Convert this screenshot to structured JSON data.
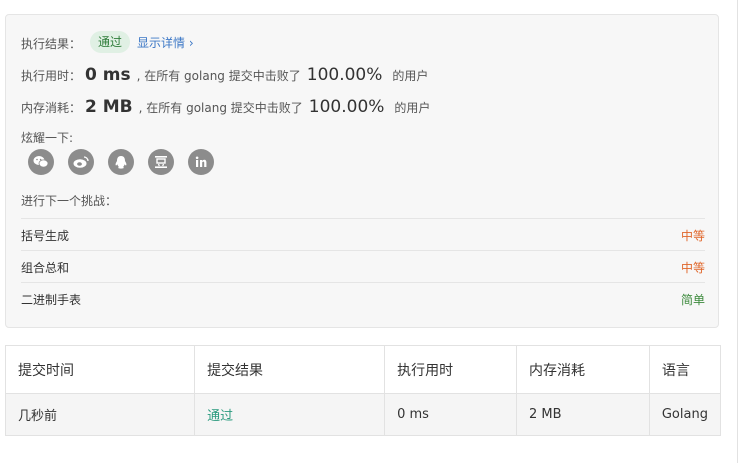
{
  "result": {
    "label": "执行结果：",
    "status": "通过",
    "details_link": "显示详情 ›"
  },
  "runtime": {
    "label": "执行用时：",
    "value": "0 ms",
    "middle": ", 在所有 golang 提交中击败了",
    "percent": "100.00%",
    "suffix": "的用户"
  },
  "memory": {
    "label": "内存消耗：",
    "value": "2 MB",
    "middle": ", 在所有 golang 提交中击败了",
    "percent": "100.00%",
    "suffix": "的用户"
  },
  "share": {
    "label": "炫耀一下:",
    "icons": [
      "wechat-icon",
      "weibo-icon",
      "qq-icon",
      "douban-icon",
      "linkedin-icon"
    ]
  },
  "next": {
    "label": "进行下一个挑战：",
    "problems": [
      {
        "name": "括号生成",
        "difficulty": "中等",
        "level": "medium"
      },
      {
        "name": "组合总和",
        "difficulty": "中等",
        "level": "medium"
      },
      {
        "name": "二进制手表",
        "difficulty": "简单",
        "level": "easy"
      }
    ]
  },
  "submissions": {
    "headers": [
      "提交时间",
      "提交结果",
      "执行用时",
      "内存消耗",
      "语言"
    ],
    "rows": [
      [
        "几秒前",
        "通过",
        "0 ms",
        "2 MB",
        "Golang"
      ]
    ]
  },
  "colors": {
    "pass": "#2a9a7e",
    "medium": "#e0662a",
    "easy": "#3c8a3c",
    "link": "#3d78c6"
  }
}
